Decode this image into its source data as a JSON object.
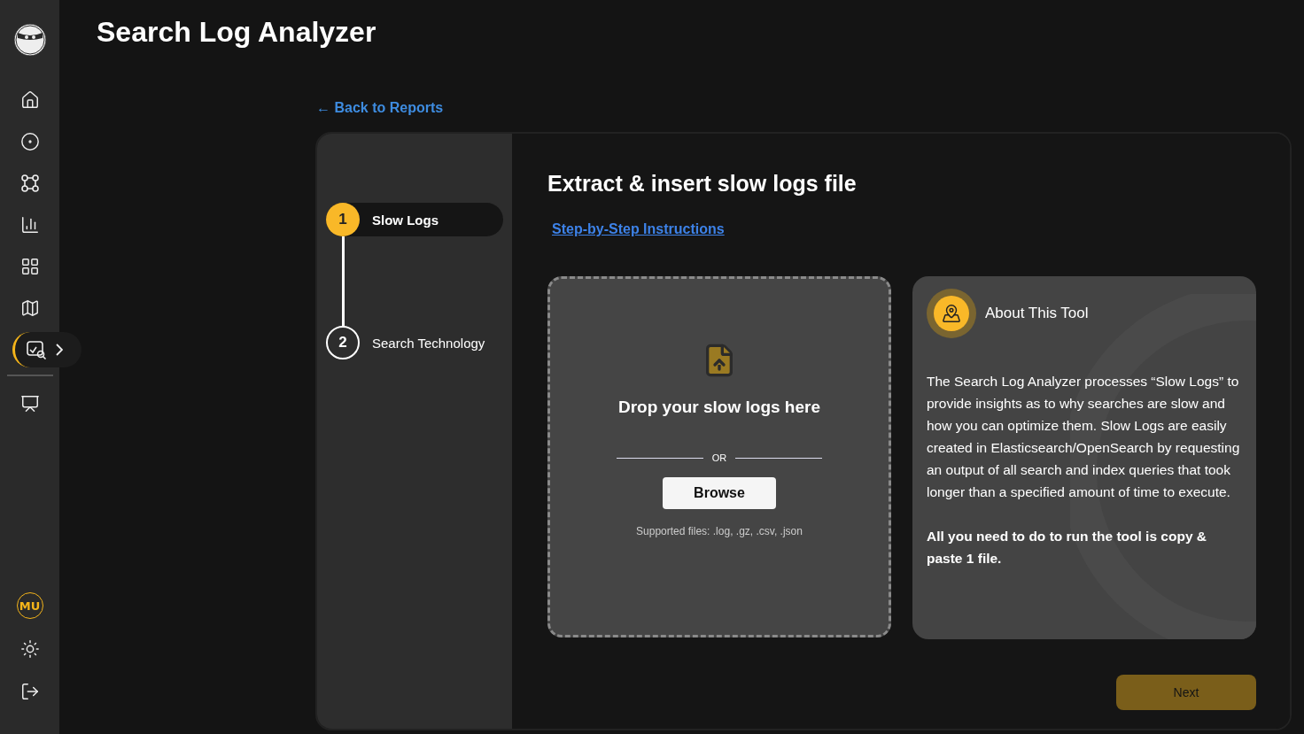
{
  "sidebar": {
    "items": [
      {
        "kind": "home",
        "selected": false
      },
      {
        "kind": "target",
        "selected": false
      },
      {
        "kind": "nodes",
        "selected": false
      },
      {
        "kind": "chart",
        "selected": false
      },
      {
        "kind": "grid",
        "selected": false
      },
      {
        "kind": "map",
        "selected": false
      },
      {
        "kind": "analyzer",
        "selected": true
      },
      {
        "kind": "presentation",
        "selected": false
      }
    ],
    "user": {
      "initials": "MU"
    },
    "bottom": [
      {
        "kind": "theme"
      },
      {
        "kind": "logout"
      }
    ]
  },
  "page": {
    "title": "Search Log Analyzer",
    "back_link": "← Back to Reports"
  },
  "steps": [
    {
      "number": "1",
      "label": "Slow Logs",
      "selected": true
    },
    {
      "number": "2",
      "label": "Search Technology",
      "selected": false
    }
  ],
  "content": {
    "heading": "Extract & insert slow logs file",
    "instructions_link": "Step-by-Step Instructions",
    "dropzone": {
      "prompt": "Drop your slow logs here",
      "separator": "OR",
      "button": "Browse",
      "hint": "Supported files: .log, .gz, .csv, .json"
    },
    "about": {
      "title": "About This Tool",
      "paragraphs": [
        {
          "text": "The Search Log Analyzer processes “Slow Logs” to provide insights as to why searches are slow and how you can optimize them. Slow Logs are easily created in Elasticsearch/OpenSearch by requesting an output of all search and index queries that took longer than a specified amount of time to execute.",
          "bold": false
        },
        {
          "text": "All you need to do to run the tool is copy & paste 1 file.",
          "bold": true
        }
      ]
    },
    "next_button": {
      "label": "Next",
      "disabled": true
    }
  }
}
